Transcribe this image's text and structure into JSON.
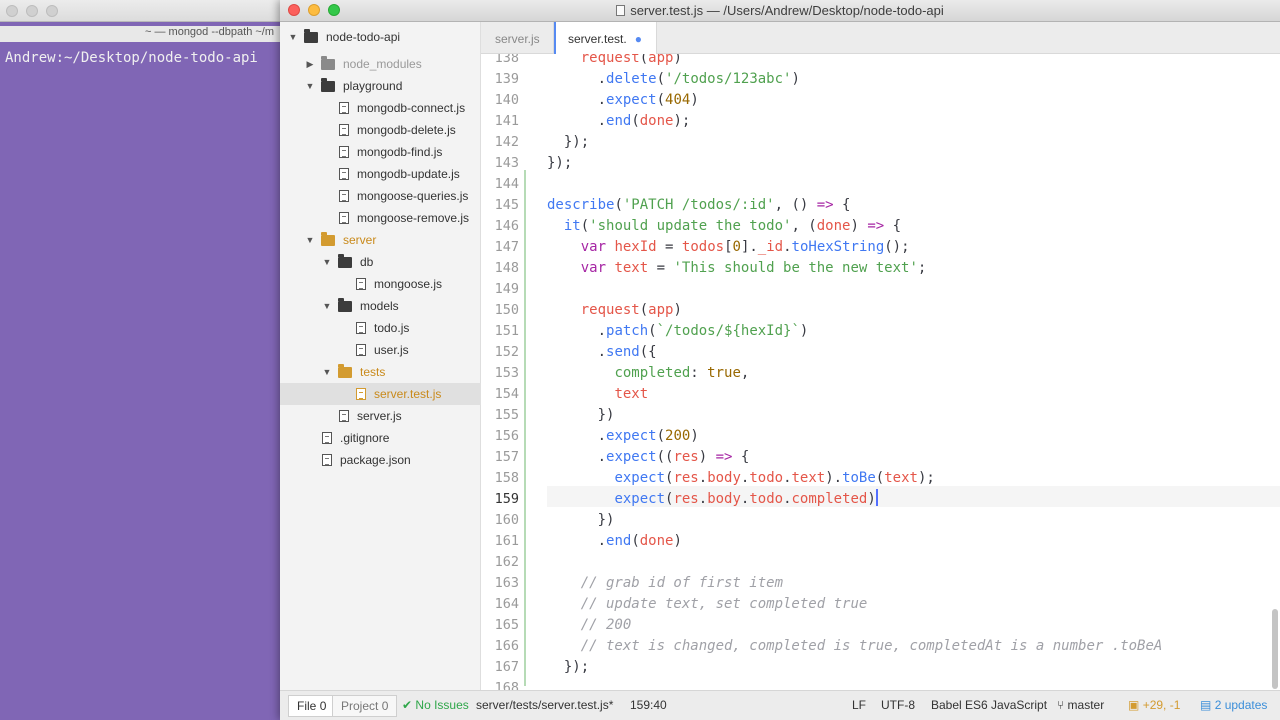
{
  "terminal": {
    "title": "~ — mongod --dbpath ~/m",
    "prompt": "Andrew:~/Desktop/node-todo-api"
  },
  "window": {
    "title": "server.test.js — /Users/Andrew/Desktop/node-todo-api"
  },
  "tree": {
    "root": "node-todo-api",
    "items": [
      {
        "label": "node_modules",
        "depth": 1,
        "kind": "folder-closed"
      },
      {
        "label": "playground",
        "depth": 1,
        "kind": "folder-open"
      },
      {
        "label": "mongodb-connect.js",
        "depth": 2,
        "kind": "file"
      },
      {
        "label": "mongodb-delete.js",
        "depth": 2,
        "kind": "file"
      },
      {
        "label": "mongodb-find.js",
        "depth": 2,
        "kind": "file"
      },
      {
        "label": "mongodb-update.js",
        "depth": 2,
        "kind": "file"
      },
      {
        "label": "mongoose-queries.js",
        "depth": 2,
        "kind": "file"
      },
      {
        "label": "mongoose-remove.js",
        "depth": 2,
        "kind": "file"
      },
      {
        "label": "server",
        "depth": 1,
        "kind": "folder-open"
      },
      {
        "label": "db",
        "depth": 2,
        "kind": "folder-open"
      },
      {
        "label": "mongoose.js",
        "depth": 3,
        "kind": "file"
      },
      {
        "label": "models",
        "depth": 2,
        "kind": "folder-open"
      },
      {
        "label": "todo.js",
        "depth": 3,
        "kind": "file"
      },
      {
        "label": "user.js",
        "depth": 3,
        "kind": "file"
      },
      {
        "label": "tests",
        "depth": 2,
        "kind": "folder-open"
      },
      {
        "label": "server.test.js",
        "depth": 3,
        "kind": "file"
      },
      {
        "label": "server.js",
        "depth": 2,
        "kind": "file"
      },
      {
        "label": ".gitignore",
        "depth": 1,
        "kind": "file"
      },
      {
        "label": "package.json",
        "depth": 1,
        "kind": "file"
      }
    ]
  },
  "tabs": [
    {
      "label": "server.js",
      "active": false
    },
    {
      "label": "server.test.",
      "active": true,
      "modified": true
    }
  ],
  "editor": {
    "line_numbers": [
      "138",
      "139",
      "140",
      "141",
      "142",
      "143",
      "144",
      "145",
      "146",
      "147",
      "148",
      "149",
      "150",
      "151",
      "152",
      "153",
      "154",
      "155",
      "156",
      "157",
      "158",
      "159",
      "160",
      "161",
      "162",
      "163",
      "164",
      "165",
      "166",
      "167",
      "168"
    ],
    "current_line": "159"
  },
  "status": {
    "file_label": "File",
    "file_count": "0",
    "project_label": "Project",
    "project_count": "0",
    "issues": "No Issues",
    "path": "server/tests/server.test.js*",
    "position": "159:40",
    "line_ending": "LF",
    "encoding": "UTF-8",
    "grammar": "Babel ES6 JavaScript",
    "branch": "master",
    "diff": "+29, -1",
    "updates": "2 updates"
  }
}
